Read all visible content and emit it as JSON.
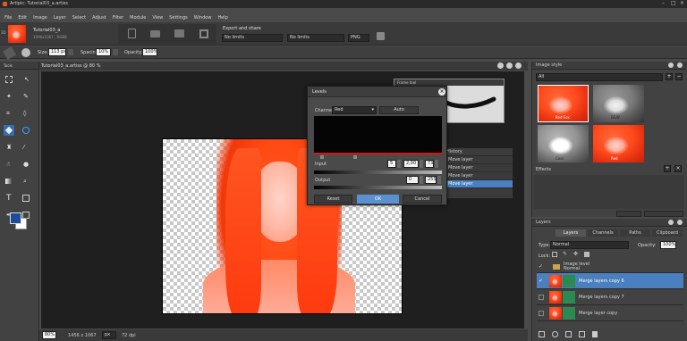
{
  "window": {
    "title": "Artipic: Tutorial03_a.artiss"
  },
  "menu": [
    "File",
    "Edit",
    "Image",
    "Layer",
    "Select",
    "Adjust",
    "Filter",
    "Module",
    "View",
    "Settings",
    "Window",
    "Help"
  ],
  "document": {
    "name": "Tutorial03_a",
    "info": "1096x1067 , RGB8"
  },
  "side_label": "3D",
  "export": {
    "title": "Export and share",
    "opt1": "No limits",
    "opt2": "No limits",
    "fmt": "PNG"
  },
  "brush": {
    "size_label": "Size:",
    "size": "113 px",
    "spacing_label": "Spacing:",
    "spacing": "10%",
    "opacity_label": "Opacity:",
    "opacity": "100%"
  },
  "tools_panel": {
    "title": "Tools"
  },
  "canvas": {
    "tab": "Tutorial03_a.artiss @ 80 %",
    "zoom": "80%",
    "dims": "1456 x 1067",
    "unit": "px",
    "dpi": "72 dpi"
  },
  "frame_tool": {
    "title": "Frame tool"
  },
  "levels": {
    "title": "Levels",
    "channel_label": "Channel:",
    "channel": "Red",
    "auto": "Auto",
    "input_label": "Input",
    "in_black": "5",
    "in_gamma": "2,00",
    "in_white": "73",
    "output_label": "Output",
    "out_black": "0",
    "out_white": "255",
    "reset": "Reset",
    "ok": "OK",
    "cancel": "Cancel"
  },
  "history": {
    "title": "History",
    "items": [
      "Move layer",
      "Move layer",
      "Move layer",
      "Move layer"
    ],
    "selected_index": 3
  },
  "image_style": {
    "title": "Image style",
    "field": "All",
    "labels": [
      "Red Fox",
      "B&W",
      "Cool",
      "Red"
    ]
  },
  "effects": {
    "title": "Effects"
  },
  "layers": {
    "title": "Layers",
    "tabs": [
      "Layers",
      "Channels",
      "Paths",
      "Clipboard"
    ],
    "type_label": "Type:",
    "type_value": "Normal",
    "opacity_label": "Opacity:",
    "opacity_value": "100%",
    "lock_label": "Lock:",
    "items": [
      {
        "name": "Image level",
        "sub": "Normal"
      },
      {
        "name": "Merge layers copy 6"
      },
      {
        "name": "Merge layers copy 7"
      },
      {
        "name": "Merge layer copy"
      }
    ]
  },
  "colors": {
    "accent": "#4a7fc0",
    "primary": "#1e4c9a",
    "secondary": "#ffffff"
  }
}
